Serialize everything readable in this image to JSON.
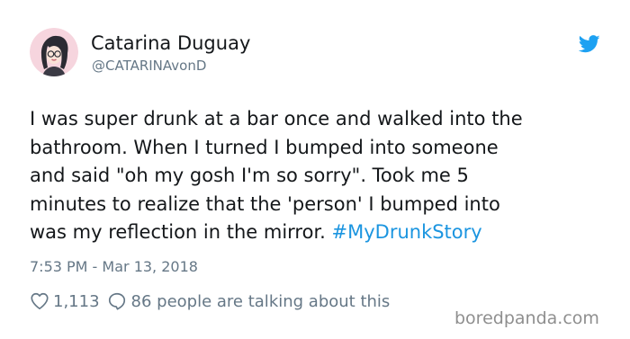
{
  "author": {
    "display_name": "Catarina Duguay",
    "handle": "@CATARINAvonD",
    "avatar_icon": "cartoon-woman-avatar-icon",
    "avatar_bg": "#f6d5de"
  },
  "platform": {
    "icon": "twitter-bird-icon",
    "color": "#1da1f2"
  },
  "tweet": {
    "lines": [
      "I was super drunk at a bar once and walked into the",
      "bathroom. When I turned I bumped into someone",
      "and said \"oh my gosh I'm so sorry\". Took me 5",
      "minutes to realize that the 'person' I bumped into",
      "was my reflection in the mirror. "
    ],
    "hashtag": "#MyDrunkStory",
    "hashtag_color": "#1b95e0",
    "timestamp": "7:53 PM - Mar 13, 2018"
  },
  "engagement": {
    "likes": "1,113",
    "talking": "86 people are talking about this",
    "like_icon": "heart-icon",
    "reply_icon": "speech-bubble-icon"
  },
  "watermark": "boredpanda.com"
}
